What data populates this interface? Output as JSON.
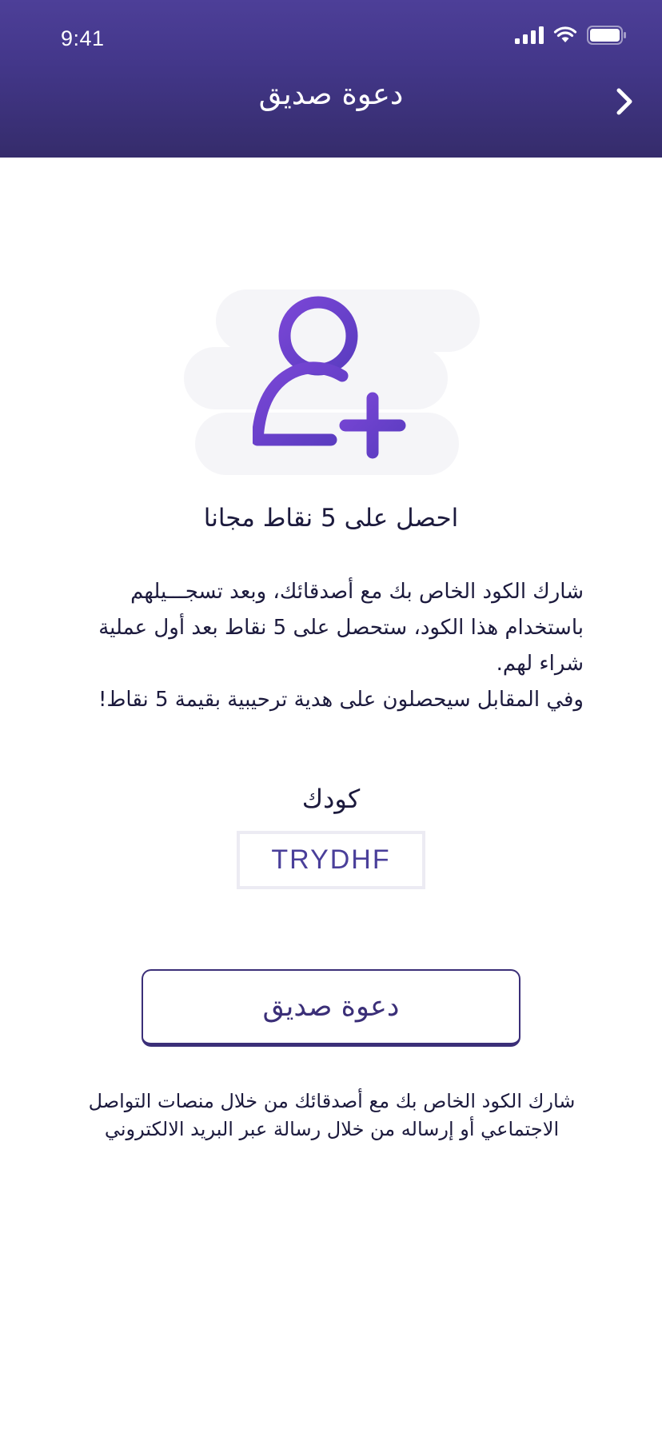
{
  "status_bar": {
    "time": "9:41",
    "icons": [
      "cellular-signal-icon",
      "wifi-icon",
      "battery-icon"
    ]
  },
  "header": {
    "title": "دعوة صديق",
    "back_icon": "chevron-right-icon"
  },
  "hero": {
    "icon": "add-user-icon"
  },
  "content": {
    "headline": "احصل على 5 نقاط مجانا",
    "description_line1": "شارك الكود الخاص بك مع أصدقائك، وبعد تسجـــيلهم باستخدام هذا الكود، ستحصل على 5 نقاط بعد أول عملية شراء لهم.",
    "description_line2": "وفي المقابل سيحصلون على هدية ترحيبية بقيمة 5 نقاط!",
    "code_label": "كودك",
    "code_value": "TRYDHF",
    "invite_button_label": "دعوة صديق",
    "footnote": "شارك الكود الخاص بك مع أصدقائك من خلال منصات التواصل الاجتماعي أو إرساله من خلال رسالة عبر البريد الالكتروني"
  },
  "colors": {
    "header_top": "#4d3f98",
    "header_bottom": "#352c6b",
    "accent_purple": "#6a3fc8",
    "button_border": "#3b2f78",
    "code_text": "#4a3f9a",
    "text_dark": "#1c1a3d"
  }
}
